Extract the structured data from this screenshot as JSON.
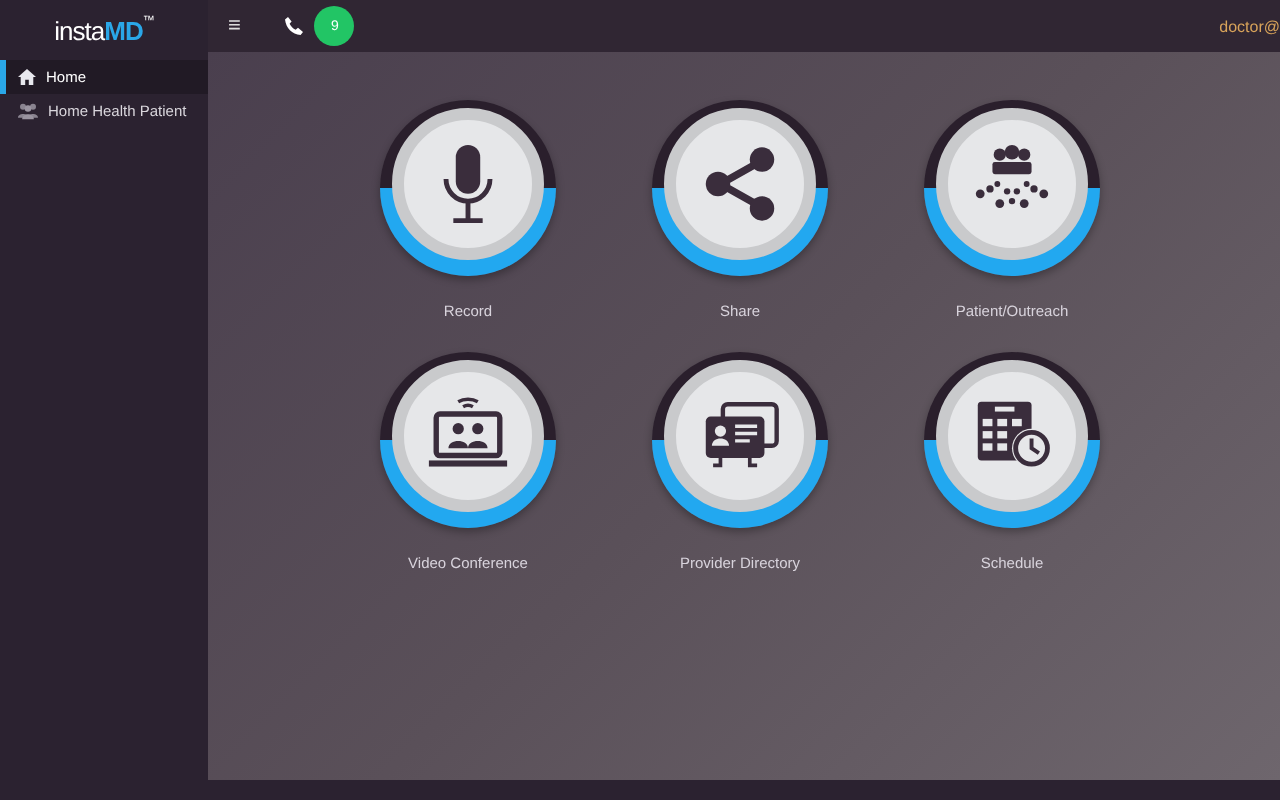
{
  "logo": {
    "prefix": "insta",
    "accent": "MD",
    "mark": "™"
  },
  "sidebar": {
    "items": [
      {
        "label": "Home",
        "kind": "home",
        "selected": true
      },
      {
        "label": "Home Health Patient",
        "kind": "group",
        "selected": false
      }
    ]
  },
  "topbar": {
    "menu": "≡",
    "badge": "9",
    "user": "doctor@"
  },
  "tiles": [
    {
      "label": "Record",
      "kind": "mic"
    },
    {
      "label": "Share",
      "kind": "share"
    },
    {
      "label": "Patient/Outreach",
      "kind": "outreach"
    },
    {
      "label": "Video Conference",
      "kind": "video"
    },
    {
      "label": "Provider Directory",
      "kind": "directory"
    },
    {
      "label": "Schedule",
      "kind": "schedule"
    }
  ]
}
